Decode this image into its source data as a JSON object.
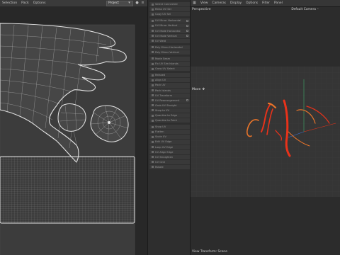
{
  "uv_editor": {
    "menu": [
      "Selection",
      "Pack",
      "Options"
    ],
    "dropdown_value": "Project",
    "toolbar_icons": [
      "record-icon",
      "options-icon"
    ]
  },
  "tool_panel": {
    "items": [
      {
        "label": "Select Connected",
        "check": false
      },
      {
        "label": "Relax UV Sel",
        "check": false
      },
      {
        "label": "Copy UV Sel",
        "check": false
      },
      {
        "label": "UV Mirror Horizontal",
        "check": true,
        "gap": true
      },
      {
        "label": "UV Mirror Vertical",
        "check": true
      },
      {
        "label": "UV Mode Horizontal",
        "check": true
      },
      {
        "label": "UV Mode Vertical",
        "check": true
      },
      {
        "label": "UV Weld",
        "check": false
      },
      {
        "label": "Poly Mirror Horizontal",
        "check": false,
        "gap": true
      },
      {
        "label": "Poly Mirror Vertical",
        "check": false
      },
      {
        "label": "Mode Seam",
        "check": false,
        "gap": true
      },
      {
        "label": "Fix UV Sim Islands",
        "check": false
      },
      {
        "label": "Grow UV Select",
        "check": false
      },
      {
        "label": "Relaxed",
        "check": false,
        "gap": true
      },
      {
        "label": "Align UV",
        "check": false
      },
      {
        "label": "Pack UV",
        "check": false
      },
      {
        "label": "Pack Islands",
        "check": false
      },
      {
        "label": "UV Transform",
        "check": false
      },
      {
        "label": "UV Rearrangement",
        "check": true
      },
      {
        "label": "Grab UV Straight",
        "check": false
      },
      {
        "label": "Snap to UV",
        "check": false
      },
      {
        "label": "Quantize to Edge",
        "check": false
      },
      {
        "label": "Quantize to Point",
        "check": false
      },
      {
        "label": "Snap UV",
        "check": false,
        "gap": true
      },
      {
        "label": "Flatten",
        "check": false
      },
      {
        "label": "Scale UV",
        "check": false
      },
      {
        "label": "Edit UV Edge",
        "check": false
      },
      {
        "label": "Loop UV Edge",
        "check": false
      },
      {
        "label": "UV Align Edge",
        "check": false
      },
      {
        "label": "UV Straighten",
        "check": false
      },
      {
        "label": "UV Grid",
        "check": false
      },
      {
        "label": "Rotate",
        "check": false
      }
    ]
  },
  "viewport": {
    "menu": [
      "View",
      "Cameras",
      "Display",
      "Options",
      "Filter",
      "Panel"
    ],
    "title": "Perspective",
    "camera": "Default Camera",
    "camera_icon": "camera-icon",
    "mode_label": "Move",
    "footer": "View Transform: Scene",
    "colors": {
      "strand_red": "#e8321a",
      "strand_orange": "#e8742a",
      "axis_green": "#3fa86a",
      "axis_blue": "#3b6fd1"
    }
  }
}
